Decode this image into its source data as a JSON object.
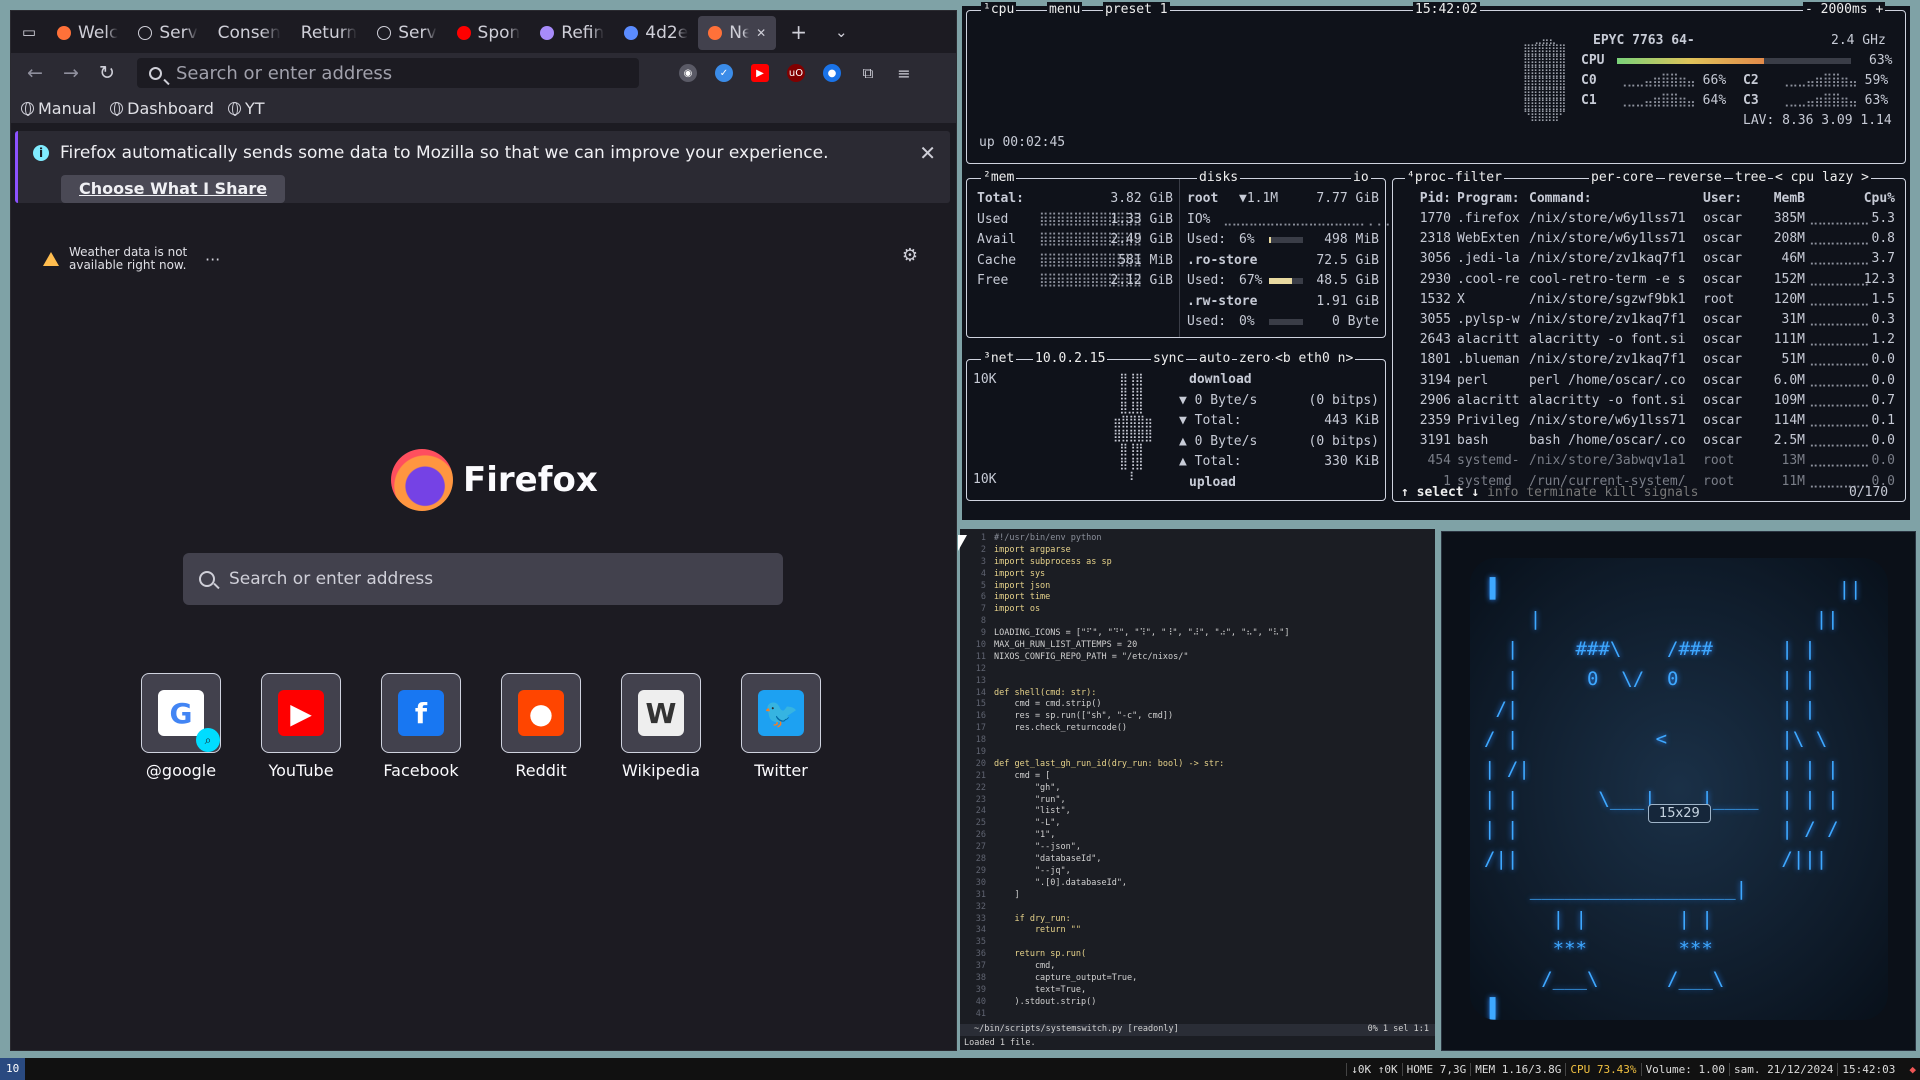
{
  "firefox": {
    "tabs": [
      {
        "label": "Welc",
        "icon": "firefox-icon",
        "color": "#ff7139"
      },
      {
        "label": "Serv",
        "icon": "info-icon",
        "color": "#cfcfd8"
      },
      {
        "label": "Consen",
        "icon": "",
        "color": ""
      },
      {
        "label": "Return",
        "icon": "",
        "color": ""
      },
      {
        "label": "Serv",
        "icon": "info-icon",
        "color": "#cfcfd8"
      },
      {
        "label": "Spon",
        "icon": "youtube-icon",
        "color": "#ff0000"
      },
      {
        "label": "Refin",
        "icon": "github-icon",
        "color": "#a78bfa"
      },
      {
        "label": "4d2e",
        "icon": "circle-icon",
        "color": "#5b8cff"
      },
      {
        "label": "Nev",
        "icon": "firefox-icon",
        "color": "#ff7139",
        "active": true
      }
    ],
    "new_tab": "+",
    "url_placeholder": "Search or enter address",
    "bookmarks": [
      "Manual",
      "Dashboard",
      "YT"
    ],
    "infobar": {
      "message": "Firefox automatically sends some data to Mozilla so that we can improve your experience.",
      "button": "Choose What I Share"
    },
    "weather": "Weather data is not available right now.",
    "brand": "Firefox",
    "search_placeholder": "Search or enter address",
    "shortcuts": [
      {
        "label": "@google",
        "letter": "G",
        "color": "#ffffff",
        "fg": "#4285f4"
      },
      {
        "label": "YouTube",
        "letter": "▶",
        "color": "#ff0000",
        "fg": "#ffffff"
      },
      {
        "label": "Facebook",
        "letter": "f",
        "color": "#1877f2",
        "fg": "#ffffff"
      },
      {
        "label": "Reddit",
        "letter": "●",
        "color": "#ff4500",
        "fg": "#ffffff"
      },
      {
        "label": "Wikipedia",
        "letter": "W",
        "color": "#eeeeee",
        "fg": "#333333"
      },
      {
        "label": "Twitter",
        "letter": "🐦",
        "color": "#1da1f2",
        "fg": "#ffffff"
      }
    ]
  },
  "btop": {
    "cpu": {
      "title": "cpu",
      "menu": "menu",
      "preset": "preset 1",
      "clock": "15:42:02",
      "interval": "- 2000ms +",
      "model": "EPYC 7763 64-",
      "freq": "2.4 GHz",
      "total_label": "CPU",
      "total_pct": "63%",
      "total_frac": 0.63,
      "cores": [
        {
          "name": "C0",
          "pct": "66%"
        },
        {
          "name": "C1",
          "pct": "64%"
        },
        {
          "name": "C2",
          "pct": "59%"
        },
        {
          "name": "C3",
          "pct": "63%"
        }
      ],
      "lav": "LAV: 8.36 3.09 1.14",
      "uptime": "up 00:02:45"
    },
    "mem": {
      "title": "mem",
      "rows": [
        {
          "k": "Total:",
          "v": "3.82 GiB"
        },
        {
          "k": "Used",
          "v": "1.33 GiB"
        },
        {
          "k": "Avail",
          "v": "2.49 GiB"
        },
        {
          "k": "Cache",
          "v": "581 MiB"
        },
        {
          "k": "Free",
          "v": "2.12 GiB"
        }
      ]
    },
    "disks": {
      "title": "disks",
      "io": "io",
      "rows": [
        {
          "k": "root",
          "m": "▼1.1M",
          "v": "7.77 GiB"
        },
        {
          "k": "IO%",
          "m": "",
          "v": ""
        },
        {
          "k": "Used:",
          "m": "6%",
          "v": "498 MiB"
        },
        {
          "k": ".ro-store",
          "m": "",
          "v": "72.5 GiB"
        },
        {
          "k": "Used:",
          "m": "67%",
          "v": "48.5 GiB"
        },
        {
          "k": ".rw-store",
          "m": "",
          "v": "1.91 GiB"
        },
        {
          "k": "Used:",
          "m": "0%",
          "v": "0 Byte"
        }
      ]
    },
    "net": {
      "title": "net",
      "ip": "10.0.2.15",
      "opts": [
        "sync",
        "auto",
        "zero",
        "<b eth0 n>"
      ],
      "scale_top": "10K",
      "scale_bottom": "10K",
      "rows": [
        {
          "k": "download",
          "v": ""
        },
        {
          "k": "▼ 0 Byte/s",
          "v": "(0 bitps)"
        },
        {
          "k": "▼ Total:",
          "v": "443 KiB"
        },
        {
          "k": "▲ 0 Byte/s",
          "v": "(0 bitps)"
        },
        {
          "k": "▲ Total:",
          "v": "330 KiB"
        },
        {
          "k": "upload",
          "v": ""
        }
      ]
    },
    "proc": {
      "title": "proc",
      "filter": "filter",
      "opts": [
        "per-core",
        "reverse",
        "tree",
        "< cpu lazy >"
      ],
      "headers": [
        "Pid:",
        "Program:",
        "Command:",
        "User:",
        "MemB",
        "Cpu%"
      ],
      "rows": [
        [
          "1770",
          ".firefox",
          "/nix/store/w6y1lss71",
          "oscar",
          "385M",
          "5.3"
        ],
        [
          "2318",
          "WebExten",
          "/nix/store/w6y1lss71",
          "oscar",
          "208M",
          "0.8"
        ],
        [
          "3056",
          ".jedi-la",
          "/nix/store/zv1kaq7f1",
          "oscar",
          "46M",
          "3.7"
        ],
        [
          "2930",
          ".cool-re",
          "cool-retro-term -e s",
          "oscar",
          "152M",
          "12.3"
        ],
        [
          "1532",
          "X",
          "/nix/store/sgzwf9bk1",
          "root",
          "120M",
          "1.5"
        ],
        [
          "3055",
          ".pylsp-w",
          "/nix/store/zv1kaq7f1",
          "oscar",
          "31M",
          "0.3"
        ],
        [
          "2643",
          "alacritt",
          "alacritty -o font.si",
          "oscar",
          "111M",
          "1.2"
        ],
        [
          "1801",
          ".blueman",
          "/nix/store/zv1kaq7f1",
          "oscar",
          "51M",
          "0.0"
        ],
        [
          "3194",
          "perl",
          "perl /home/oscar/.co",
          "oscar",
          "6.0M",
          "0.0"
        ],
        [
          "2906",
          "alacritt",
          "alacritty -o font.si",
          "oscar",
          "109M",
          "0.7"
        ],
        [
          "2359",
          "Privileg",
          "/nix/store/w6y1lss71",
          "oscar",
          "114M",
          "0.1"
        ],
        [
          "3191",
          "bash",
          "bash /home/oscar/.co",
          "oscar",
          "2.5M",
          "0.0"
        ],
        [
          "454",
          "systemd-",
          "/nix/store/3abwqv1a1",
          "root",
          "13M",
          "0.0"
        ],
        [
          "1",
          "systemd",
          "/run/current-system/",
          "root",
          "11M",
          "0.0"
        ]
      ],
      "footer": [
        "select",
        "info",
        "terminate",
        "kill",
        "signals"
      ],
      "count": "0/170"
    }
  },
  "editor": {
    "lines": [
      "#!/usr/bin/env python",
      "import argparse",
      "import subprocess as sp",
      "import sys",
      "import json",
      "import time",
      "import os",
      "",
      "LOADING_ICONS = [\"⠋\", \"⠙\", \"⠹\", \"⠸\", \"⠼\", \"⠴\", \"⠦\", \"⠧\"]",
      "MAX_GH_RUN_LIST_ATTEMPS = 20",
      "NIXOS_CONFIG_REPO_PATH = \"/etc/nixos/\"",
      "",
      "",
      "def shell(cmd: str):",
      "    cmd = cmd.strip()",
      "    res = sp.run([\"sh\", \"-c\", cmd])",
      "    res.check_returncode()",
      "",
      "",
      "def get_last_gh_run_id(dry_run: bool) -> str:",
      "    cmd = [",
      "        \"gh\",",
      "        \"run\",",
      "        \"list\",",
      "        \"-L\",",
      "        \"1\",",
      "        \"--json\",",
      "        \"databaseId\",",
      "        \"--jq\",",
      "        \".[0].databaseId\",",
      "    ]",
      "",
      "    if dry_run:",
      "        return \"\"",
      "",
      "    return sp.run(",
      "        cmd,",
      "        capture_output=True,",
      "        text=True,",
      "    ).stdout.strip()",
      ""
    ],
    "status_left": "~/bin/scripts/systemswitch.py  [readonly]",
    "status_right": "0%   1 sel  1:1",
    "cmdline": "Loaded 1 file."
  },
  "retro": {
    "art": "▐                              ||\n    |                        ||\n  |     ###\\    /###      | |\n  |      0  \\/  0         | |\n /|                       | |\n/ |            <          |\\ \\\n| /|                      | | |\n| |       \\___|    |____  | | |\n| |                       | / /\n/||                       /|||\n    __________________|\n      | |        | |\n      ***        ***\n     /___\\      /___\\\n▐",
    "size": "15x29"
  },
  "statusbar": {
    "workspace": "10",
    "segments": [
      "↓0K ↑0K",
      "HOME 7,3G",
      "MEM 1.16/3.8G",
      "CPU 73.43%",
      "Volume: 1.00",
      "sam. 21/12/2024",
      "15:42:03"
    ]
  }
}
